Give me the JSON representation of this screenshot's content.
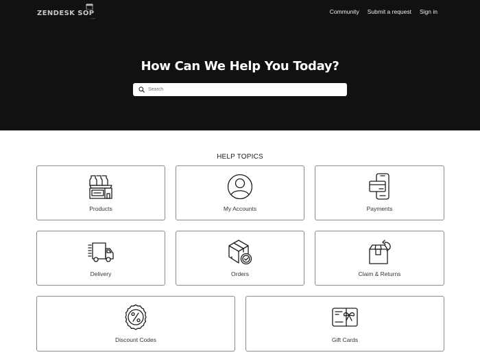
{
  "header": {
    "logo_text_1": "ZENDESK S",
    "logo_text_2": "OP",
    "logo_suffix": ".com",
    "nav": [
      {
        "label": "Community"
      },
      {
        "label": "Submit a request"
      },
      {
        "label": "Sign in"
      }
    ]
  },
  "hero": {
    "title": "How Can We Help You Today?",
    "search_placeholder": "Search",
    "search_value": ""
  },
  "topics": {
    "heading": "HELP TOPICS",
    "items": [
      {
        "label": "Products",
        "icon": "products-box-icon"
      },
      {
        "label": "My Accounts",
        "icon": "user-account-icon"
      },
      {
        "label": "Payments",
        "icon": "credit-card-phone-icon"
      },
      {
        "label": "Delivery",
        "icon": "delivery-truck-icon"
      },
      {
        "label": "Orders",
        "icon": "package-check-icon"
      },
      {
        "label": "Claim & Returns",
        "icon": "package-return-icon"
      },
      {
        "label": "Discount Codes",
        "icon": "discount-badge-icon"
      },
      {
        "label": "Gift Cards",
        "icon": "gift-card-icon"
      }
    ]
  },
  "colors": {
    "hero_bg": "#111111",
    "card_border": "#8a8a8a",
    "text_dark": "#222222"
  }
}
